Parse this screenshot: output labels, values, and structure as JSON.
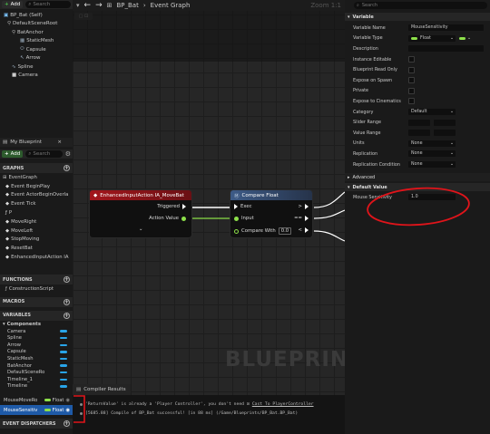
{
  "left": {
    "add_label": "Add",
    "search_placeholder": "Search",
    "tree": [
      "BP_Bat (Self)",
      "DefaultSceneRoot",
      "BatAnchor",
      "StaticMesh",
      "Capsule",
      "Arrow",
      "Spline",
      "Camera"
    ],
    "myblueprint_title": "My Blueprint",
    "add2_label": "Add",
    "search2_placeholder": "Search",
    "graphs_header": "GRAPHS",
    "event_graph": "EventGraph",
    "graph_items": [
      "Event BeginPlay",
      "Event ActorBeginOverla",
      "Event Tick",
      "P",
      "MoveRight",
      "MoveLeft",
      "StopMoving",
      "ResetBat",
      "EnhancedInputAction IA"
    ],
    "functions_header": "FUNCTIONS",
    "function_items": [
      "ConstructionScript"
    ],
    "macros_header": "MACROS",
    "variables_header": "VARIABLES",
    "components_label": "Components",
    "component_vars": [
      "Camera",
      "Spline",
      "Arrow",
      "Capsule",
      "StaticMesh",
      "BatAnchor",
      "DefaultSceneRo",
      "Timeline_1",
      "Timeline"
    ],
    "var_rows": [
      {
        "name": "MouseMoveRo",
        "type": "Float"
      },
      {
        "name": "MouseSensitiv",
        "type": "Float"
      }
    ],
    "dispatchers_header": "EVENT DISPATCHERS"
  },
  "graph": {
    "breadcrumb_bp": "BP_Bat",
    "breadcrumb_sep": "›",
    "breadcrumb_graph": "Event Graph",
    "zoom": "Zoom 1:1",
    "watermark": "BLUEPRINT",
    "node_input": {
      "title": "EnhancedInputAction IA_MoveBat",
      "pin_triggered": "Triggered",
      "pin_action_value": "Action Value"
    },
    "node_compare": {
      "title": "Compare Float",
      "pin_exec": "Exec",
      "pin_input": "Input",
      "pin_compare": "Compare With",
      "compare_value": "0.0",
      "out_gt": ">",
      "out_eq": "==",
      "out_lt": "<"
    }
  },
  "compiler": {
    "tab_label": "Compiler Results",
    "lines": [
      "'ReturnValue' is already a 'Player Controller', you don't need",
      "[5685.88] Compile of BP_Bat successful! [in 88 ms] (/Game/Blueprints/BP_Bat.BP_Bat)"
    ],
    "cast_link": "Cast To PlayerController"
  },
  "details": {
    "search_placeholder": "Search",
    "variable_header": "Variable",
    "rows": [
      {
        "label": "Variable Name",
        "value": "MouseSensitivity",
        "kind": "text"
      },
      {
        "label": "Variable Type",
        "value": "Float",
        "kind": "type"
      },
      {
        "label": "Description",
        "value": "",
        "kind": "text"
      },
      {
        "label": "Instance Editable",
        "kind": "check"
      },
      {
        "label": "Blueprint Read Only",
        "kind": "check"
      },
      {
        "label": "Expose on Spawn",
        "kind": "check"
      },
      {
        "label": "Private",
        "kind": "check"
      },
      {
        "label": "Expose to Cinematics",
        "kind": "check"
      },
      {
        "label": "Category",
        "value": "Default",
        "kind": "select"
      },
      {
        "label": "Slider Range",
        "kind": "range"
      },
      {
        "label": "Value Range",
        "kind": "range"
      },
      {
        "label": "Units",
        "value": "None",
        "kind": "select"
      },
      {
        "label": "Replication",
        "value": "None",
        "kind": "select"
      },
      {
        "label": "Replication Condition",
        "value": "None",
        "kind": "select"
      }
    ],
    "advanced_header": "Advanced",
    "default_value_header": "Default Value",
    "default_label": "Mouse Sensitivity",
    "default_value": "1.0"
  },
  "colors": {
    "accent": "#29a4e8",
    "float_green": "#8de04a",
    "annotation_red": "#e0141a",
    "input_node_red": "#a3161c",
    "compare_node_blue": "#3d5b87"
  }
}
